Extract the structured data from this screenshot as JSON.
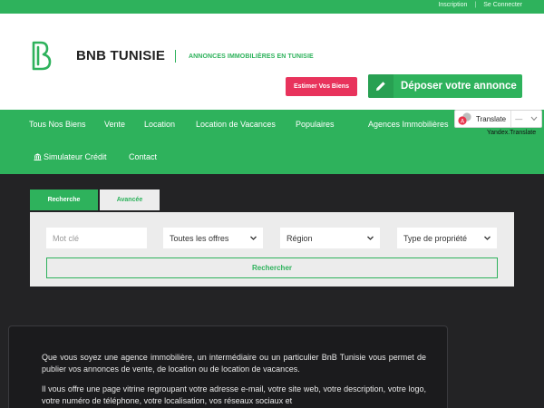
{
  "topbar": {
    "inscription": "Inscription",
    "separator": "|",
    "connect": "Se Connecter"
  },
  "header": {
    "brand": "BNB TUNISIE",
    "tagline": "ANNONCES IMMOBILIÈRES EN TUNISIE",
    "estimer_label": "Estimer Vos Biens",
    "deposer_label": "Déposer votre annonce"
  },
  "nav": {
    "items": [
      "Tous Nos Biens",
      "Vente",
      "Location",
      "Location de Vacances",
      "Populaires",
      "Agences Immobilières",
      "Simulateur Crédit",
      "Contact"
    ]
  },
  "translate": {
    "label": "Translate",
    "dash": "—",
    "yandex": "Yandex.Translate"
  },
  "search": {
    "tabs": [
      "Recherche",
      "Avancée"
    ],
    "keyword_placeholder": "Mot clé",
    "offers": "Toutes les offres",
    "region": "Région",
    "property_type": "Type de propriété",
    "submit_label": "Rechercher"
  },
  "info": {
    "p1": "Que vous soyez une agence immobilière, un intermédiaire ou un particulier BnB Tunisie vous permet de publier vos annonces de vente, de location ou de location de vacances.",
    "p2": "Il vous offre une page vitrine regroupant votre adresse e-mail, votre site web, votre description, votre logo, votre numéro de téléphone, votre localisation, vos réseaux sociaux et"
  },
  "colors": {
    "brand_green": "#2eb25c",
    "accent_pink": "#e8335c",
    "dark_bg": "#232325"
  }
}
